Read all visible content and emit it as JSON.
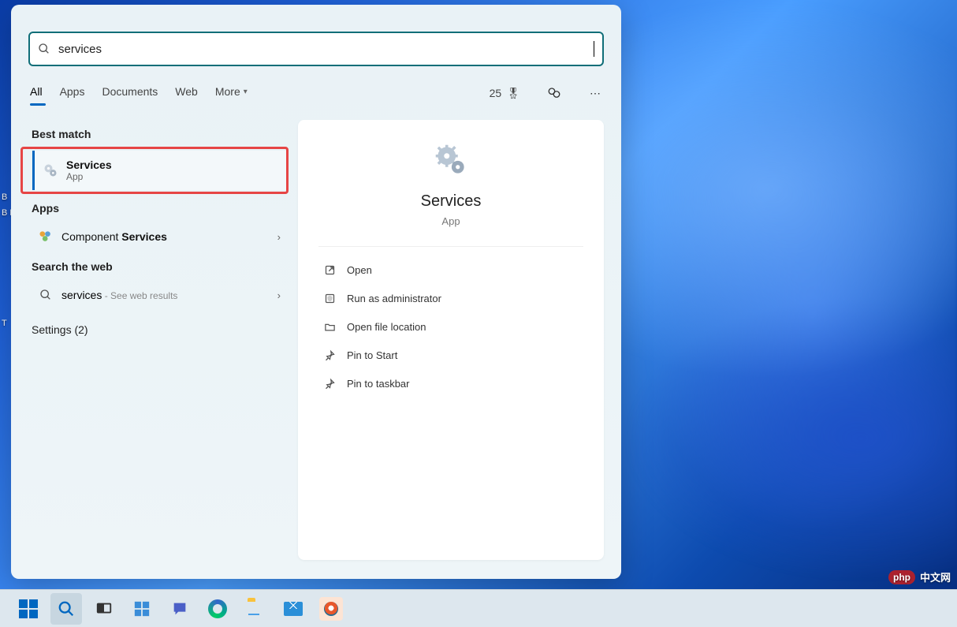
{
  "search": {
    "value": "services"
  },
  "tabs": {
    "all": "All",
    "apps": "Apps",
    "documents": "Documents",
    "web": "Web",
    "more": "More"
  },
  "header": {
    "points": "25"
  },
  "sections": {
    "best_match": "Best match",
    "apps": "Apps",
    "search_web": "Search the web",
    "settings": "Settings (2)"
  },
  "results": {
    "best": {
      "title": "Services",
      "subtitle": "App"
    },
    "component": {
      "prefix": "Component ",
      "bold": "Services"
    },
    "web": {
      "term": "services",
      "suffix": " - See web results"
    }
  },
  "preview": {
    "title": "Services",
    "subtitle": "App",
    "actions": {
      "open": "Open",
      "admin": "Run as administrator",
      "file_loc": "Open file location",
      "pin_start": "Pin to Start",
      "pin_taskbar": "Pin to taskbar"
    }
  },
  "watermark": {
    "badge": "php",
    "text": "中文网"
  },
  "desktop": {
    "b": "B",
    "bm": "B M",
    "t": "T"
  }
}
